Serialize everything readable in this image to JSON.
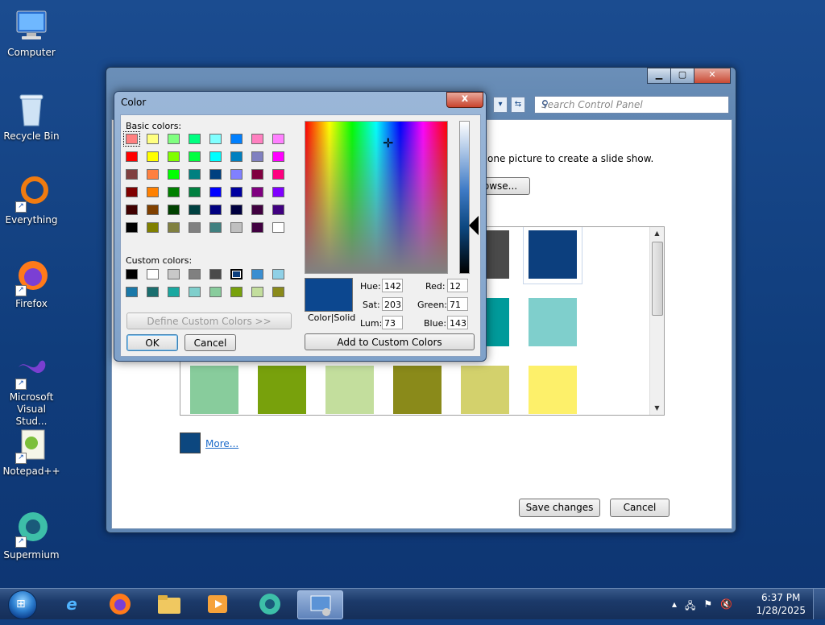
{
  "desktop": {
    "icons": [
      {
        "label": "Computer"
      },
      {
        "label": "Recycle Bin"
      },
      {
        "label": "Everything"
      },
      {
        "label": "Firefox"
      },
      {
        "label": "Microsoft Visual Stud..."
      },
      {
        "label": "Notepad++"
      },
      {
        "label": "Supermium"
      }
    ]
  },
  "control_panel": {
    "search_placeholder": "Search Control Panel",
    "description": "one picture to create a slide show.",
    "browse_label": "owse...",
    "more_link": "More...",
    "save_label": "Save changes",
    "cancel_label": "Cancel",
    "swatches": [
      {
        "color": "#4a4a4a"
      },
      {
        "color": "#0c3f7e"
      },
      {
        "color": "#009a9a"
      },
      {
        "color": "#7fcfcc"
      },
      {
        "color": "#88cc9c"
      },
      {
        "color": "#78a10c"
      },
      {
        "color": "#c3de9d"
      },
      {
        "color": "#8a8a1a"
      },
      {
        "color": "#d3d16c"
      },
      {
        "color": "#fdf06a"
      }
    ],
    "selected_swatch_color": "#0c477f"
  },
  "color_dialog": {
    "title": "Color",
    "close_glyph": "x",
    "basic_colors_label": "Basic colors:",
    "custom_colors_label": "Custom colors:",
    "define_custom_label": "Define Custom Colors >>",
    "ok_label": "OK",
    "cancel_label": "Cancel",
    "add_custom_label": "Add to Custom Colors",
    "preview_label": "Color|Solid",
    "hue_label": "Hue:",
    "hue": "142",
    "sat_label": "Sat:",
    "sat": "203",
    "lum_label": "Lum:",
    "lum": "73",
    "red_label": "Red:",
    "red": "12",
    "green_label": "Green:",
    "green": "71",
    "blue_label": "Blue:",
    "blue": "143",
    "basic_colors": [
      "#ff8080",
      "#ffff80",
      "#80ff80",
      "#00ff80",
      "#80ffff",
      "#0080ff",
      "#ff80c0",
      "#ff80ff",
      "#ff0000",
      "#ffff00",
      "#80ff00",
      "#00ff40",
      "#00ffff",
      "#0080c0",
      "#8080c0",
      "#ff00ff",
      "#804040",
      "#ff8040",
      "#00ff00",
      "#008080",
      "#004080",
      "#8080ff",
      "#800040",
      "#ff0080",
      "#800000",
      "#ff8000",
      "#008000",
      "#008040",
      "#0000ff",
      "#0000a0",
      "#800080",
      "#8000ff",
      "#400000",
      "#804000",
      "#004000",
      "#004040",
      "#000080",
      "#000040",
      "#400040",
      "#400080",
      "#000000",
      "#808000",
      "#808040",
      "#808080",
      "#408080",
      "#c0c0c0",
      "#400040",
      "#ffffff"
    ],
    "custom_colors": [
      "#000000",
      "#ffffff",
      "#c8c8c8",
      "#808080",
      "#4a4a4a",
      "#0c3f7e",
      "#3a8ed1",
      "#8fd0e6",
      "#1a78a8",
      "#1a6e6e",
      "#1aa8a0",
      "#7fcfcc",
      "#88cc9c",
      "#78a10c",
      "#c3de9d",
      "#8a8a1a"
    ]
  },
  "taskbar": {
    "time": "6:37 PM",
    "date": "1/28/2025"
  }
}
